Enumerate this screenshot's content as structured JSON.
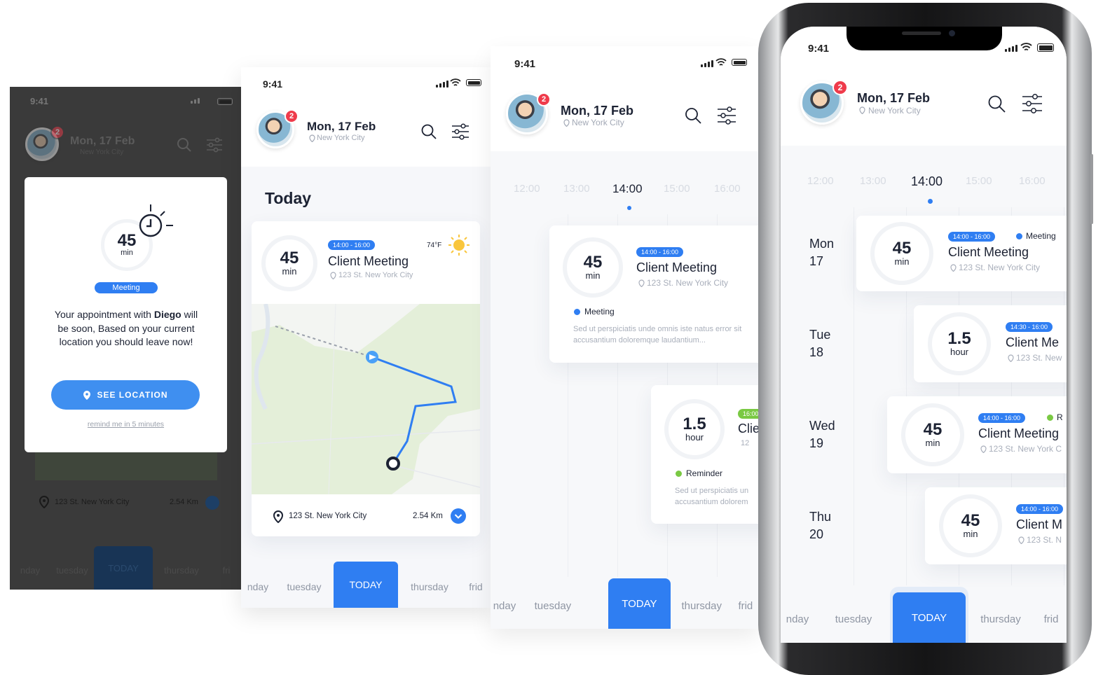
{
  "status": {
    "time": "9:41"
  },
  "header": {
    "date": "Mon, 17 Feb",
    "city": "New York City",
    "notifications": "2"
  },
  "icons": {
    "search": "search-icon",
    "filter": "filter-sliders-icon",
    "pin": "location-pin-icon",
    "bell": "notification-badge",
    "alarm": "alarm-clock-icon",
    "sun": "sun-icon",
    "chevron": "chevron-down-icon"
  },
  "colors": {
    "accent": "#2f7ef2",
    "badge": "#ef3b4b",
    "reminder": "#7ac943",
    "sun": "#f9c63d",
    "map": "#e4efd9"
  },
  "tabs": {
    "monday": "nday",
    "tuesday": "tuesday",
    "today": "TODAY",
    "thursday": "thursday",
    "friday": "frid",
    "friday_short": "fri"
  },
  "hours": [
    "12:00",
    "13:00",
    "14:00",
    "15:00",
    "16:00"
  ],
  "alert": {
    "duration": "45",
    "unit": "min",
    "category": "Meeting",
    "message_pre": "Your appointment with ",
    "contact": "Diego",
    "message_post": " will be soon, Based on your current location you should leave now!",
    "button": "SEE LOCATION",
    "remind": "remind me in 5 minutes",
    "address": "123 St. New York City",
    "distance": "2.54 Km"
  },
  "today": {
    "heading": "Today",
    "time_range": "14:00 - 16:00",
    "temp": "74°F",
    "title": "Client Meeting",
    "address": "123 St. New York City",
    "duration": "45",
    "unit": "min",
    "footer_address": "123 St. New York City",
    "distance": "2.54 Km"
  },
  "timeline": {
    "card1": {
      "duration": "45",
      "unit": "min",
      "time_range": "14:00 - 16:00",
      "title": "Client Meeting",
      "address": "123 St. New York City",
      "category": "Meeting",
      "body": "Sed ut perspiciatis unde omnis iste natus error sit accusantium doloremque laudantium..."
    },
    "card2": {
      "duration": "1.5",
      "unit": "hour",
      "time_range": "16:00",
      "title": "Clie",
      "address": "12",
      "category": "Reminder",
      "body1": "Sed ut perspiciatis un",
      "body2": "accusantium dolorem"
    }
  },
  "week": {
    "days": [
      {
        "name": "Mon",
        "num": "17",
        "duration": "45",
        "unit": "min",
        "time_range": "14:00 - 16:00",
        "category": "Meeting",
        "title": "Client Meeting",
        "address": "123 St. New York City"
      },
      {
        "name": "Tue",
        "num": "18",
        "duration": "1.5",
        "unit": "hour",
        "time_range": "14:30 - 16:00",
        "category": "",
        "title": "Client Me",
        "address": "123 St. New"
      },
      {
        "name": "Wed",
        "num": "19",
        "duration": "45",
        "unit": "min",
        "time_range": "14:00 - 16:00",
        "category": "R",
        "title": "Client Meeting",
        "address": "123 St. New York C"
      },
      {
        "name": "Thu",
        "num": "20",
        "duration": "45",
        "unit": "min",
        "time_range": "14:00 - 16:00",
        "category": "",
        "title": "Client M",
        "address": "123 St. N"
      }
    ]
  }
}
